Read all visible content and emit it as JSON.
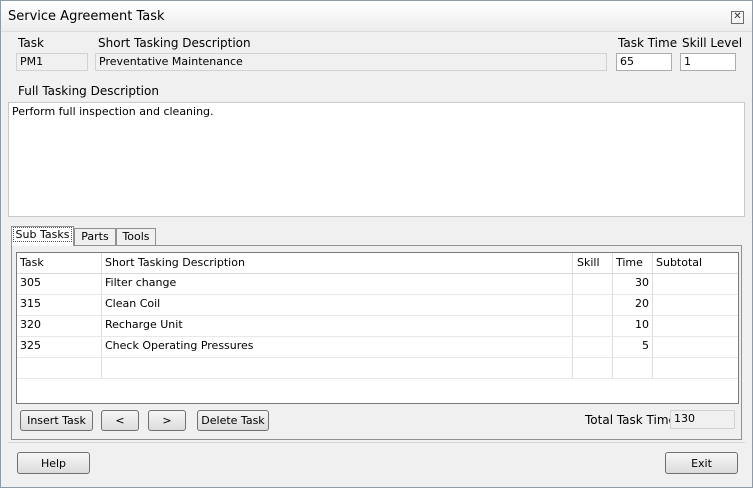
{
  "window": {
    "title": "Service Agreement Task",
    "close_glyph": "✕"
  },
  "header": {
    "task_label": "Task",
    "task_value": "PM1",
    "short_desc_label": "Short Tasking Description",
    "short_desc_value": "Preventative Maintenance",
    "task_time_label": "Task Time",
    "task_time_value": "65",
    "skill_level_label": "Skill Level",
    "skill_level_value": "1"
  },
  "full_description": {
    "label": "Full Tasking Description",
    "value": "Perform full inspection and cleaning."
  },
  "tabs": [
    {
      "label": "Sub Tasks",
      "active": true
    },
    {
      "label": "Parts",
      "active": false
    },
    {
      "label": "Tools",
      "active": false
    }
  ],
  "grid": {
    "columns": [
      "Task",
      "Short Tasking Description",
      "Skill",
      "Time",
      "Subtotal"
    ],
    "rows": [
      {
        "task": "305",
        "desc": "Filter change",
        "skill": "",
        "time": "30",
        "subtotal": ""
      },
      {
        "task": "315",
        "desc": "Clean Coil",
        "skill": "",
        "time": "20",
        "subtotal": ""
      },
      {
        "task": "320",
        "desc": "Recharge Unit",
        "skill": "",
        "time": "10",
        "subtotal": ""
      },
      {
        "task": "325",
        "desc": "Check Operating Pressures",
        "skill": "",
        "time": "5",
        "subtotal": ""
      }
    ]
  },
  "subtask_toolbar": {
    "insert_label": "Insert Task",
    "prev_label": "<",
    "next_label": ">",
    "delete_label": "Delete Task",
    "total_label": "Total Task Time",
    "total_value": "130"
  },
  "footer": {
    "help_label": "Help",
    "exit_label": "Exit"
  }
}
